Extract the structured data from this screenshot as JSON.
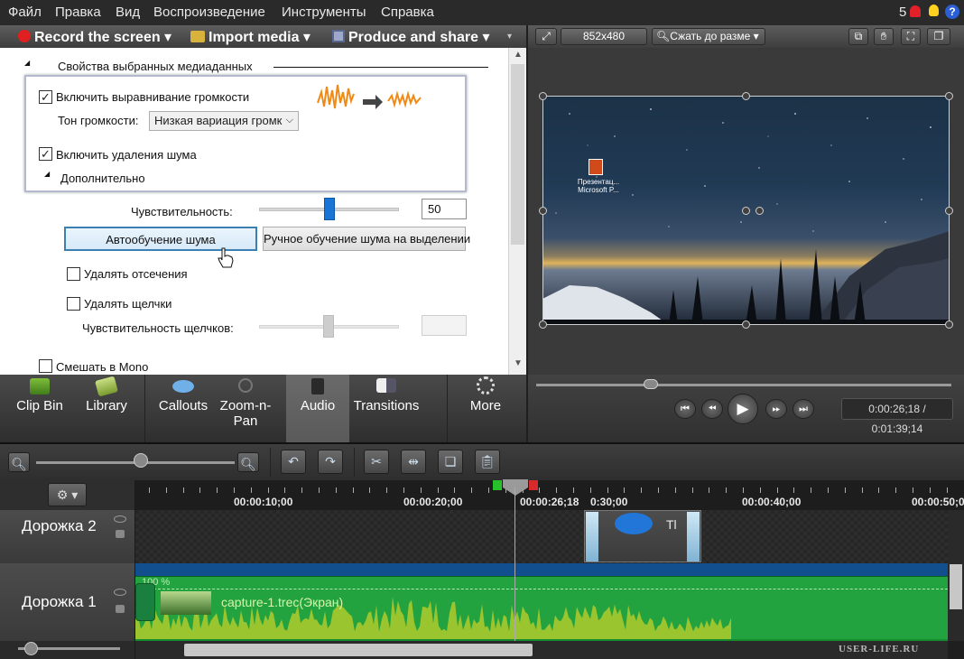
{
  "menu": [
    "Файл",
    "Правка",
    "Вид",
    "Воспроизведение",
    "Инструменты",
    "Справка"
  ],
  "notifications": "5",
  "help_symbol": "?",
  "toolbar": {
    "record": "Record the screen",
    "import": "Import media",
    "produce": "Produce and share"
  },
  "properties": {
    "section_title": "Свойства выбранных медиаданных",
    "volume_leveling_label": "Включить выравнивание громкости",
    "volume_tone_label": "Тон громкости:",
    "volume_tone_value": "Низкая вариация громк",
    "noise_removal_label": "Включить удаления шума",
    "advanced_label": "Дополнительно",
    "sensitivity_label": "Чувствительность:",
    "sensitivity_value": "50",
    "sensitivity_level": 0.5,
    "auto_noise_button": "Автообучение шума",
    "manual_noise_button": "Ручное обучение шума на выделении",
    "remove_clipping_label": "Удалять отсечения",
    "remove_clicks_label": "Удалять щелчки",
    "click_sensitivity_label": "Чувствительность щелчков:",
    "mix_mono_label": "Смешать в Mono"
  },
  "tabs": [
    {
      "label": "Clip Bin"
    },
    {
      "label": "Library"
    },
    {
      "label": "Callouts"
    },
    {
      "label": "Zoom-n-\nPan"
    },
    {
      "label": "Audio"
    },
    {
      "label": "Transitions"
    },
    {
      "label": "More"
    }
  ],
  "preview": {
    "size": "852x480",
    "fit_option": "Сжать до разме",
    "desktop_icon_label": "Презентац... Microsoft P..."
  },
  "playback": {
    "timecode": "0:00:26;18 / 0:01:39;14"
  },
  "timeline": {
    "ruler_labels": [
      "00:00:10;00",
      "00:00:20;00",
      "00:00:26;18",
      "0:30;00",
      "00:00:40;00",
      "00:00:50;0"
    ],
    "tracks": [
      {
        "name": "Дорожка 2"
      },
      {
        "name": "Дорожка 1"
      }
    ],
    "callout_clip_text": "Tl",
    "audio_clip_name": "capture-1.trec(Экран)",
    "volume_label": "100 %"
  },
  "watermark": "USER-LIFE.RU",
  "colors": {
    "accent": "#1875d6",
    "track_green": "#23a240",
    "record_red": "#e02020"
  }
}
